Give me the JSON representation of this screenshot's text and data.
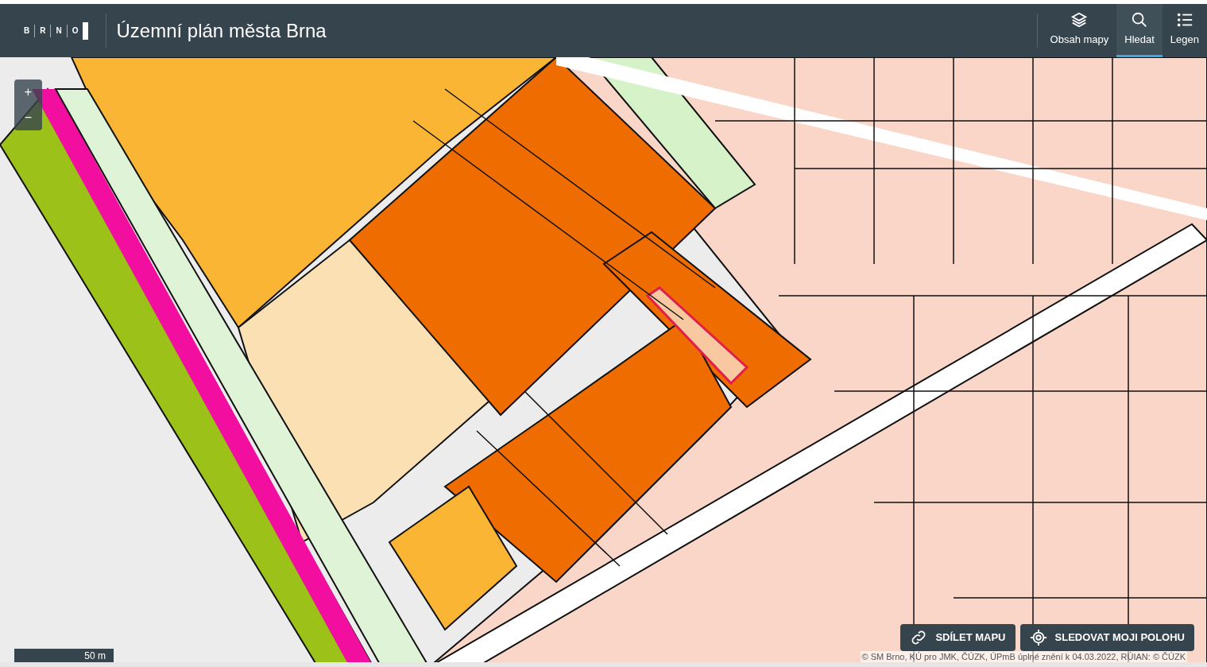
{
  "header": {
    "logo_letters": [
      "B",
      "R",
      "N",
      "O"
    ],
    "title": "Územní plán města Brna"
  },
  "tabs": [
    {
      "label": "Obsah mapy",
      "selected": false
    },
    {
      "label": "Hledat",
      "selected": true
    },
    {
      "label": "Legen",
      "selected": false
    }
  ],
  "zoom": {
    "in": "+",
    "out": "−"
  },
  "scale": {
    "label": "50 m"
  },
  "actions": [
    {
      "label": "SDÍLET MAPU"
    },
    {
      "label": "SLEDOVAT MOJI POLOHU"
    }
  ],
  "attribution": "© SM Brno, KÚ pro JMK, ČÚZK, ÚPmB úplné znění k 04.03.2022, RÚIAN: © ČÚZK"
}
